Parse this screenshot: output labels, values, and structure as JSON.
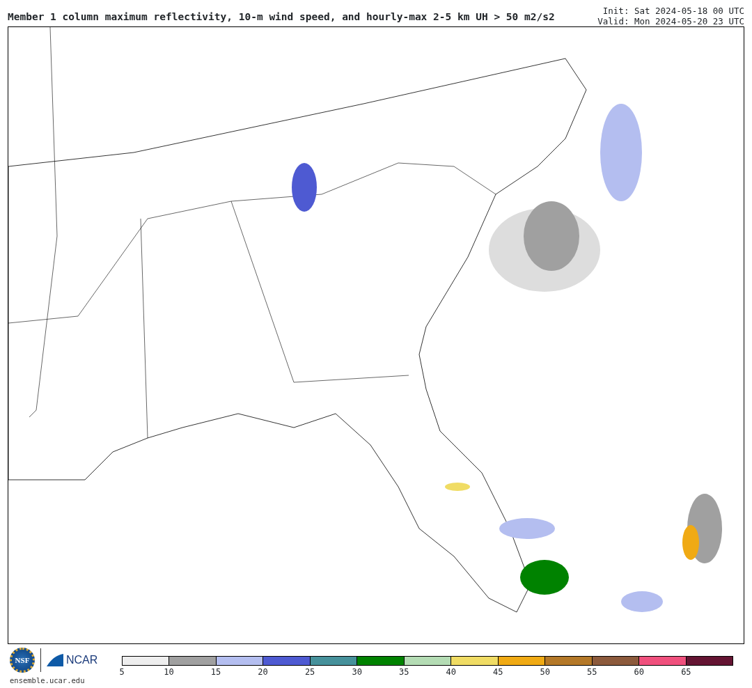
{
  "header": {
    "title": "Member 1 column maximum reflectivity, 10-m wind speed, and hourly-max 2-5 km UH > 50 m2/s2",
    "init": "Init: Sat 2024-05-18 00 UTC",
    "valid": "Valid: Mon 2024-05-20 23 UTC"
  },
  "footer": {
    "logo_nsf": "NSF",
    "logo_ncar": "NCAR",
    "url": "ensemble.ucar.edu"
  },
  "colorbar": {
    "bins": [
      {
        "label": "5",
        "color": "#eeeeee"
      },
      {
        "label": "10",
        "color": "#a0a0a0"
      },
      {
        "label": "15",
        "color": "#b4bef0"
      },
      {
        "label": "20",
        "color": "#4e5ad2"
      },
      {
        "label": "25",
        "color": "#46919b"
      },
      {
        "label": "30",
        "color": "#008200"
      },
      {
        "label": "35",
        "color": "#b4dcb4"
      },
      {
        "label": "40",
        "color": "#f0dc64"
      },
      {
        "label": "45",
        "color": "#f0aa14"
      },
      {
        "label": "50",
        "color": "#b47828"
      },
      {
        "label": "55",
        "color": "#8c5a3c"
      },
      {
        "label": "60",
        "color": "#f0507d"
      },
      {
        "label": "65",
        "color": "#641432"
      }
    ]
  }
}
